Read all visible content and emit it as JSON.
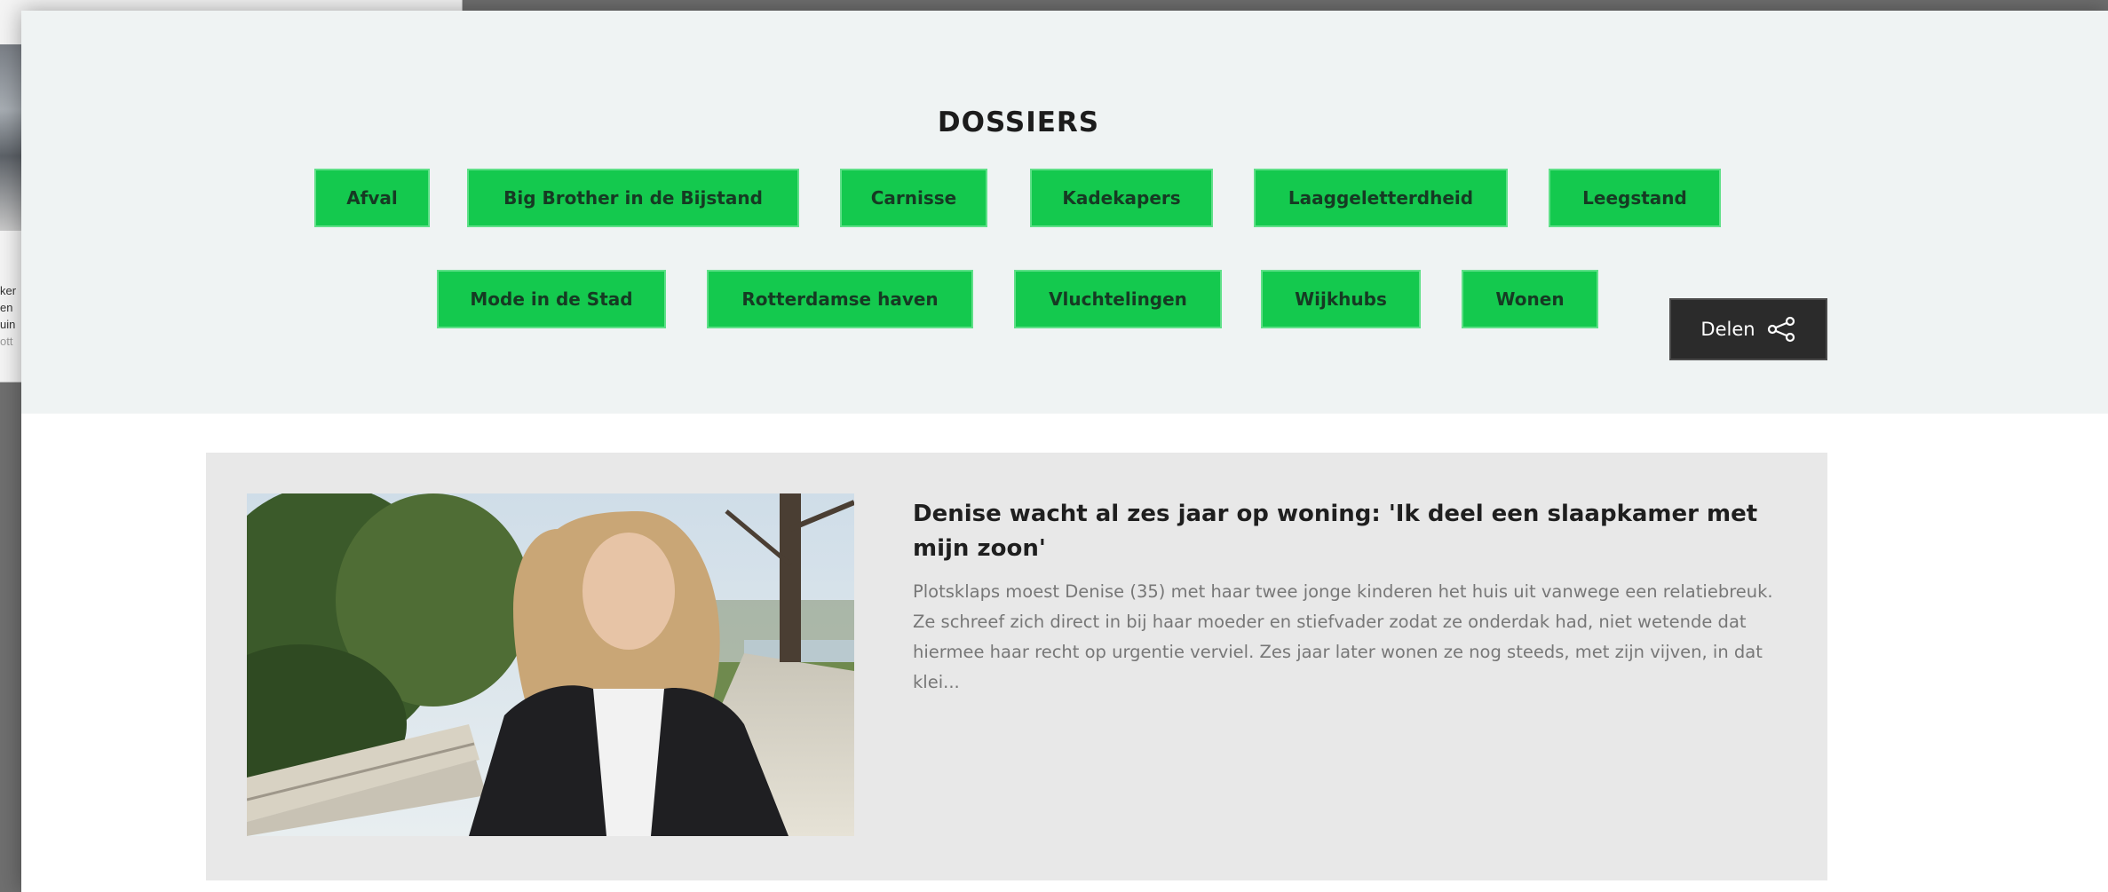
{
  "dossiers": {
    "title": "DOSSIERS",
    "tags": [
      {
        "label": "Afval"
      },
      {
        "label": "Big Brother in de Bijstand"
      },
      {
        "label": "Carnisse"
      },
      {
        "label": "Kadekapers"
      },
      {
        "label": "Laaggeletterdheid"
      },
      {
        "label": "Leegstand"
      },
      {
        "label": "Mode in de Stad"
      },
      {
        "label": "Rotterdamse haven"
      },
      {
        "label": "Vluchtelingen"
      },
      {
        "label": "Wijkhubs"
      },
      {
        "label": "Wonen"
      }
    ],
    "share_label": "Delen"
  },
  "article": {
    "title": "Denise wacht al zes jaar op woning: 'Ik deel een slaapkamer met mijn zoon'",
    "summary": "Plotsklaps moest Denise (35) met haar twee jonge kinderen het huis uit vanwege een relatiebreuk. Ze schreef zich direct in bij haar moeder en stiefvader zodat ze onderdak had, niet wetende dat hiermee haar recht op urgentie verviel. Zes jaar later wonen ze nog steeds, met zijn vijven, in dat klei..."
  },
  "colors": {
    "tag_background": "#14c94e",
    "header_background": "#eff3f3",
    "card_background": "#e8e8e8",
    "share_background": "#2b2b2b"
  }
}
